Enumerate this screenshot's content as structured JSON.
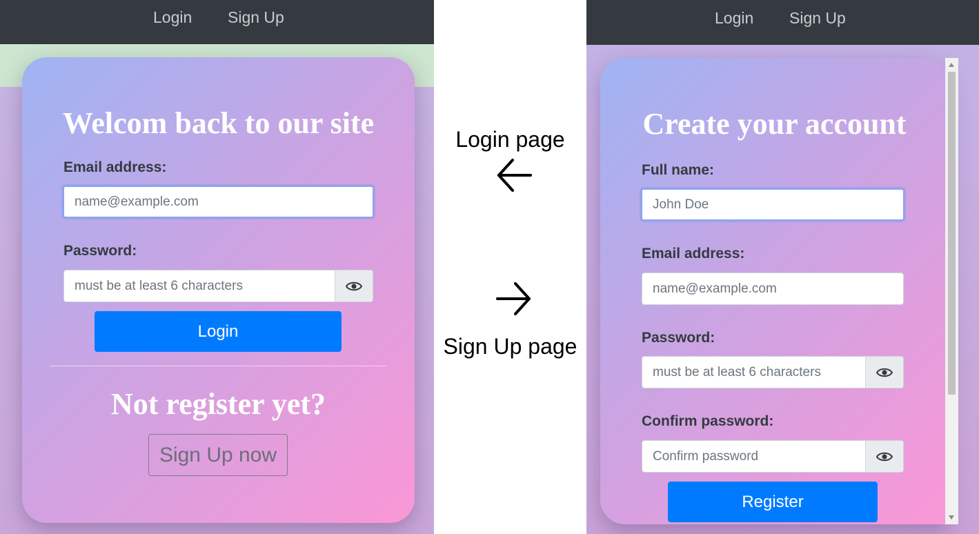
{
  "login_screen": {
    "navbar": {
      "login_link": "Login",
      "signup_link": "Sign Up"
    },
    "heading": "Welcom back to our site",
    "email_label": "Email address:",
    "email_placeholder": "name@example.com",
    "password_label": "Password:",
    "password_placeholder": "must be at least 6 characters",
    "login_button": "Login",
    "register_prompt": "Not register yet?",
    "signup_button": "Sign Up now"
  },
  "annotations": {
    "login_page": "Login page",
    "signup_page": "Sign Up page",
    "left_arrow_icon": "arrow-left-icon",
    "right_arrow_icon": "arrow-right-icon"
  },
  "signup_screen": {
    "navbar": {
      "login_link": "Login",
      "signup_link": "Sign Up"
    },
    "heading": "Create your account",
    "fullname_label": "Full name:",
    "fullname_placeholder": "John Doe",
    "email_label": "Email address:",
    "email_placeholder": "name@example.com",
    "password_label": "Password:",
    "password_placeholder": "must be at least 6 characters",
    "confirm_label": "Confirm password:",
    "confirm_placeholder": "Confirm password",
    "register_button": "Register"
  },
  "icons": {
    "password_toggle": "eye-icon"
  },
  "colors": {
    "navbar": "#343a40",
    "primary": "#007bff",
    "card_gradient_start": "#9fb4f3",
    "card_gradient_end": "#fb97d6"
  }
}
